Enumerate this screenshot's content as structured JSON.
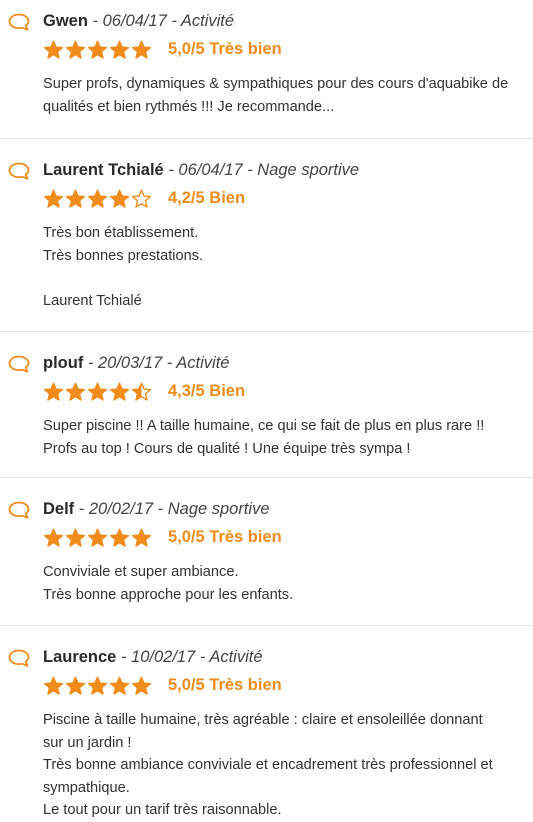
{
  "colors": {
    "accent": "#f08c19",
    "star": "#f08c19",
    "separator": "#e2e2e2"
  },
  "icons": {
    "review": "speech-bubble-icon",
    "star": "star-icon"
  },
  "reviews": [
    {
      "author": "Gwen",
      "meta": " - 06/04/17 - Activité",
      "rating": 5,
      "score_text": "5,0/5 Très bien",
      "lines": [
        "Super profs, dynamiques & sympathiques pour des cours d'aquabike de",
        "qualités et bien rythmés !!! Je recommande..."
      ]
    },
    {
      "author": "Laurent Tchialé",
      "meta": " - 06/04/17 - Nage sportive",
      "rating": 4,
      "score_text": "4,2/5 Bien",
      "lines": [
        "Très bon établissement.",
        "Très bonnes prestations.",
        "",
        "Laurent Tchialé"
      ]
    },
    {
      "author": "plouf",
      "meta": " - 20/03/17 - Activité",
      "rating": 4.5,
      "score_text": "4,3/5 Bien",
      "lines": [
        "Super piscine !! A taille humaine, ce qui se fait de plus en plus rare !!",
        "Profs au top ! Cours de qualité ! Une équipe très sympa !"
      ]
    },
    {
      "author": "Delf",
      "meta": " - 20/02/17 - Nage sportive",
      "rating": 5,
      "score_text": "5,0/5 Très bien",
      "lines": [
        "Conviviale et super ambiance.",
        "Très bonne approche pour les enfants."
      ]
    },
    {
      "author": "Laurence",
      "meta": " - 10/02/17 - Activité",
      "rating": 5,
      "score_text": "5,0/5 Très bien",
      "lines": [
        "Piscine à taille humaine, très agréable : claire et ensoleillée donnant",
        "sur un jardin !",
        "Très bonne ambiance conviviale et encadrement très professionnel et",
        "sympathique.",
        "Le tout pour un tarif très raisonnable."
      ]
    }
  ]
}
